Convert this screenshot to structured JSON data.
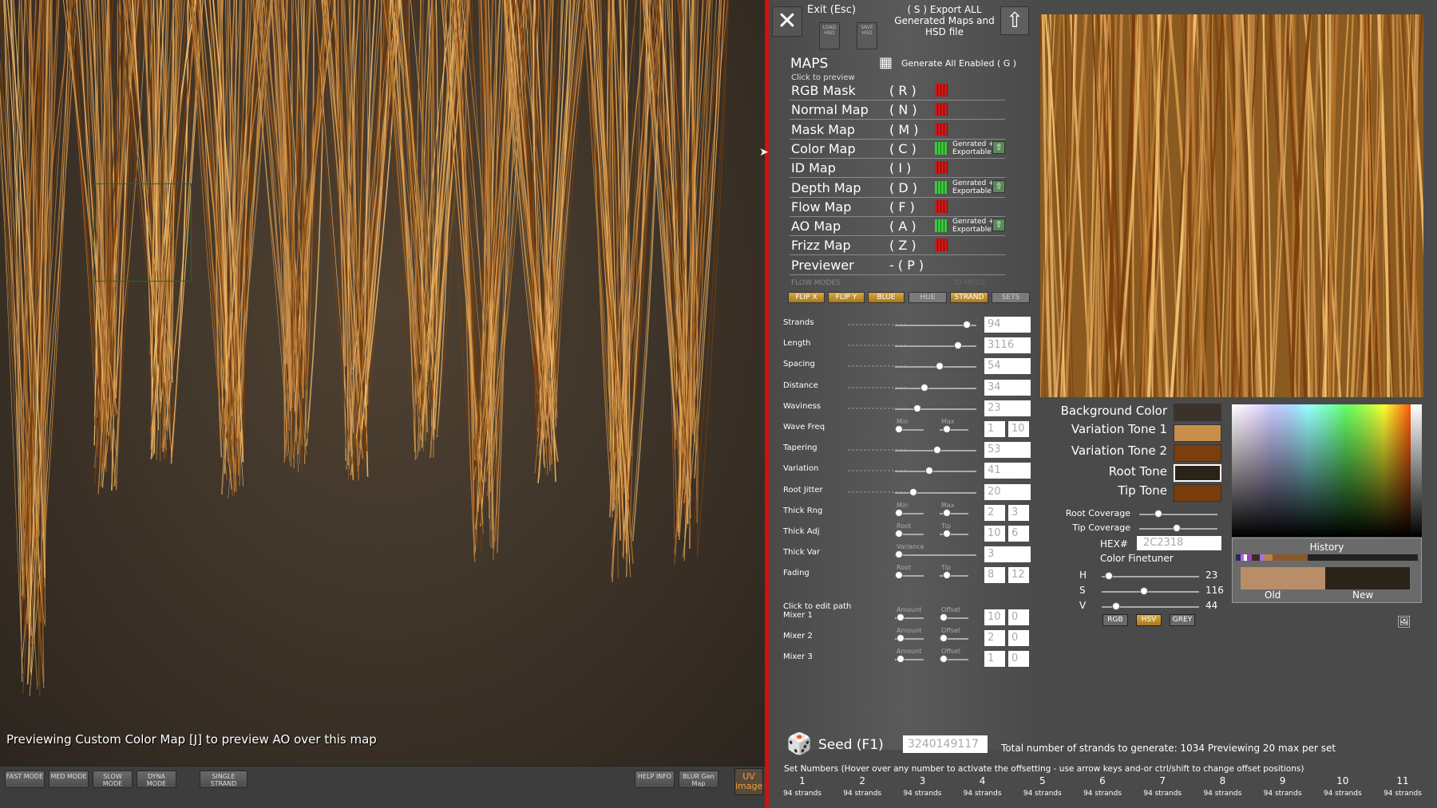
{
  "viewport": {
    "status_text": "Previewing Custom Color Map  [J] to preview AO over this map"
  },
  "bottom_bar": {
    "buttons": [
      {
        "label": "FAST MODE"
      },
      {
        "label": "MED MODE"
      },
      {
        "label": "SLOW MODE"
      },
      {
        "label": "DYNA MODE"
      },
      {
        "label": "SINGLE STRAND"
      },
      {
        "label": "HELP INFO"
      },
      {
        "label": "BLUR Gen Map"
      }
    ],
    "uv_label": "UV image"
  },
  "header": {
    "exit_label": "Exit (Esc)",
    "load_hsd": "LOAD HSD",
    "save_hsd": "SAVE HSD",
    "export_label": "( S ) Export ALL Generated Maps and HSD file"
  },
  "maps": {
    "title": "MAPS",
    "generate_all": "Generate All Enabled ( G )",
    "click_preview": "Click to preview",
    "items": [
      {
        "name": "RGB Mask",
        "key": "( R )",
        "enabled": false,
        "status": ""
      },
      {
        "name": "Normal Map",
        "key": "( N )",
        "enabled": false,
        "status": ""
      },
      {
        "name": "Mask Map",
        "key": "( M )",
        "enabled": false,
        "status": ""
      },
      {
        "name": "Color Map",
        "key": "( C )",
        "enabled": true,
        "status": "Genrated + Exportable"
      },
      {
        "name": "ID Map",
        "key": "( I )",
        "enabled": false,
        "status": ""
      },
      {
        "name": "Depth Map",
        "key": "( D )",
        "enabled": true,
        "status": "Genrated + Exportable"
      },
      {
        "name": "Flow Map",
        "key": "( F )",
        "enabled": false,
        "status": ""
      },
      {
        "name": "AO Map",
        "key": "( A )",
        "enabled": true,
        "status": "Genrated + Exportable"
      },
      {
        "name": "Frizz Map",
        "key": "( Z )",
        "enabled": false,
        "status": ""
      },
      {
        "name": "Previewer",
        "key": "- ( P )",
        "enabled": false,
        "status": ""
      }
    ],
    "flow_modes": "FLOW MODES",
    "id_mode": "ID MODE",
    "mode_buttons": [
      "FLIP X",
      "FLIP Y",
      "BLUE",
      "HUE",
      "STRAND",
      "SETS"
    ]
  },
  "sliders": [
    {
      "label": "Strands",
      "value": "94"
    },
    {
      "label": "Length",
      "value": "3116"
    },
    {
      "label": "Spacing",
      "value": "54"
    },
    {
      "label": "Distance",
      "value": "34"
    },
    {
      "label": "Waviness",
      "value": "23"
    },
    {
      "label": "Wave Freq",
      "value": "1",
      "value2": "10",
      "mini1": "Min",
      "mini2": "Max"
    },
    {
      "label": "Tapering",
      "value": "53"
    },
    {
      "label": "Variation",
      "value": "41"
    },
    {
      "label": "Root Jitter",
      "value": "20"
    },
    {
      "label": "Thick Rng",
      "value": "2",
      "value2": "3",
      "mini1": "Min",
      "mini2": "Max"
    },
    {
      "label": "Thick Adj",
      "value": "10",
      "value2": "6",
      "mini1": "Root",
      "mini2": "Tip"
    },
    {
      "label": "Thick Var",
      "value": "3",
      "mini1": "Variance"
    },
    {
      "label": "Fading",
      "value": "8",
      "value2": "12",
      "mini1": "Root",
      "mini2": "Tip"
    }
  ],
  "mixers": {
    "click_edit": "Click to edit path",
    "items": [
      {
        "label": "Mixer 1",
        "amount": "10",
        "offset": "0"
      },
      {
        "label": "Mixer 2",
        "amount": "2",
        "offset": "0"
      },
      {
        "label": "Mixer 3",
        "amount": "1",
        "offset": "0"
      }
    ],
    "amount_label": "Amount",
    "offset_label": "Offset"
  },
  "colors": {
    "background_label": "Background Color",
    "variation1_label": "Variation Tone 1",
    "variation2_label": "Variation Tone 2",
    "root_label": "Root Tone",
    "tip_label": "Tip Tone",
    "background_color": "#3b3329",
    "variation1_color": "#c98e4a",
    "variation2_color": "#7a3f0d",
    "root_color": "#2c2318",
    "tip_color": "#7a3c0a",
    "root_coverage_label": "Root Coverage",
    "tip_coverage_label": "Tip Coverage",
    "hex_label": "HEX#",
    "hex_value": "2C2318",
    "finetuner": "Color Finetuner",
    "h_label": "H",
    "h_value": "23",
    "s_label": "S",
    "s_value": "116",
    "v_label": "V",
    "v_value": "44",
    "mode_rgb": "RGB",
    "mode_hsv": "HSV",
    "mode_grey": "GREY",
    "history_title": "History",
    "old_label": "Old",
    "new_label": "New"
  },
  "seed": {
    "label": "Seed (F1)",
    "value": "3240149117",
    "total_text": "Total number of strands to generate: 1034  Previewing 20 max per set",
    "set_help": "Set Numbers (Hover over any number to activate the offsetting - use arrow keys and-or ctrl/shift to change offset positions)",
    "sets": [
      {
        "num": "1",
        "strands": "94 strands"
      },
      {
        "num": "2",
        "strands": "94 strands"
      },
      {
        "num": "3",
        "strands": "94 strands"
      },
      {
        "num": "4",
        "strands": "94 strands"
      },
      {
        "num": "5",
        "strands": "94 strands"
      },
      {
        "num": "6",
        "strands": "94 strands"
      },
      {
        "num": "7",
        "strands": "94 strands"
      },
      {
        "num": "8",
        "strands": "94 strands"
      },
      {
        "num": "9",
        "strands": "94 strands"
      },
      {
        "num": "10",
        "strands": "94 strands"
      },
      {
        "num": "11",
        "strands": "94 strands"
      }
    ]
  }
}
